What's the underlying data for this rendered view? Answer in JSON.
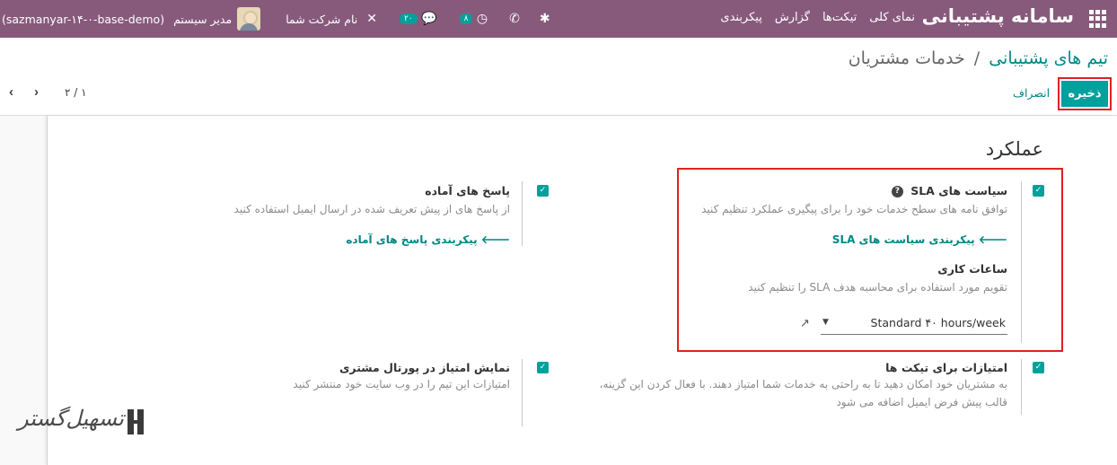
{
  "navbar": {
    "brand": "سامانه پشتیبانی",
    "menu": [
      "نمای کلی",
      "تیکت‌ها",
      "گزارش",
      "پیکربندی"
    ],
    "activity_count": "۸",
    "messages_count": "۲۰",
    "company": "نام شرکت شما",
    "user": "مدیر سیستم",
    "database": "(sazmanyar-۱۴-۰-base-demo)",
    "bg_color": "#875a7b",
    "icons": [
      "apps-icon",
      "bug-icon",
      "phone-icon",
      "clock-icon",
      "chat-icon",
      "tools-icon"
    ]
  },
  "breadcrumb": {
    "parent": "تیم های پشتیبانی",
    "separator": "/",
    "current": "خدمات مشتریان"
  },
  "buttons": {
    "save": "ذخیره",
    "cancel": "انصراف"
  },
  "pager": {
    "value": "۲ / ۱"
  },
  "section": {
    "title": "عملکرد"
  },
  "settings": {
    "sla": {
      "checked": true,
      "title": "سیاست های SLA",
      "description": "توافق نامه های سطح خدمات خود را برای پیگیری عملکرد تنظیم کنید",
      "link": "پیکربندی سیاست های SLA",
      "working_hours_title": "ساعات کاری",
      "working_hours_desc": "تقویم مورد استفاده برای محاسبه هدف SLA را تنظیم کنید",
      "working_hours_value": "Standard ۴۰ hours/week"
    },
    "canned": {
      "checked": true,
      "title": "پاسخ های آماده",
      "description": "از پاسخ های از پیش تعریف شده در ارسال ایمیل استفاده کنید",
      "link": "پیکربندی پاسخ های آماده"
    },
    "rating": {
      "checked": true,
      "title": "امتیازات برای تیکت ها",
      "description_line1": "به مشتریان خود امکان دهید تا به راحتی به خدمات شما امتیاز دهند. با فعال کردن این گزینه،",
      "description_line2": "قالب پیش فرض ایمیل اضافه می شود"
    },
    "portal_rating": {
      "checked": true,
      "title": "نمایش امتیاز در پورتال مشتری",
      "description": "امتیازات این تیم را در وب سایت خود منتشر کنید"
    }
  },
  "watermark": {
    "text": "تسهیل‌گستر"
  },
  "colors": {
    "primary": "#00a09d",
    "link": "#008784",
    "highlight": "#e02020"
  }
}
